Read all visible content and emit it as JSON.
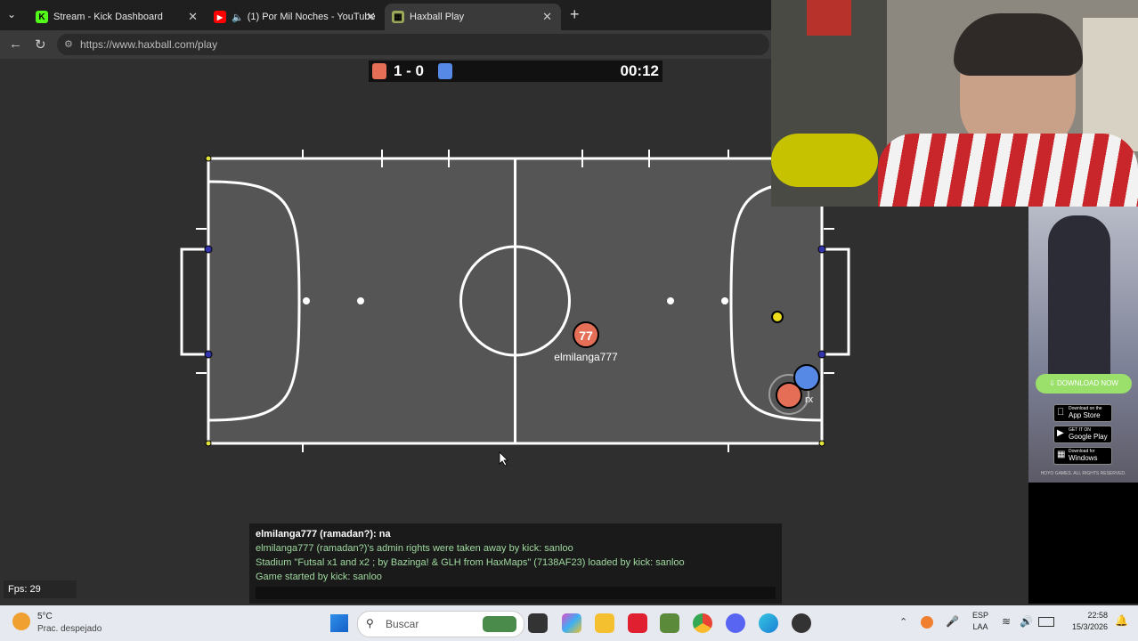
{
  "tabs": [
    {
      "title": "Stream - Kick Dashboard",
      "icon": "kick-icon"
    },
    {
      "title": "(1) Por Mil Noches - YouTube",
      "icon": "youtube-icon"
    },
    {
      "title": "Haxball Play",
      "icon": "haxball-icon"
    }
  ],
  "address": {
    "url": "https://www.haxball.com/play"
  },
  "scoreboard": {
    "score": "1 - 0",
    "time": "00:12",
    "red": "#e56e56",
    "blue": "#5689e5"
  },
  "players": [
    {
      "number": "77",
      "name": "elmilanga777",
      "team": "red"
    },
    {
      "number": "",
      "name": "",
      "team": "red"
    },
    {
      "number": "",
      "name": "",
      "team": "blue"
    }
  ],
  "field": {
    "avatar_partial": "rx"
  },
  "fps": "Fps: 29",
  "chat": {
    "lines": [
      "elmilanga777 (ramadan?): na",
      "elmilanga777 (ramadan?)'s admin rights were taken away by kick: sanloo",
      "Stadium \"Futsal x1 and x2 ; by Bazinga! & GLH from HaxMaps\" (7138AF23) loaded by kick: sanloo",
      "Game started by kick: sanloo"
    ]
  },
  "ad": {
    "download": "DOWNLOAD NOW",
    "stores": [
      {
        "small": "Download on the",
        "big": "App Store"
      },
      {
        "small": "GET IT ON",
        "big": "Google Play"
      },
      {
        "small": "Download for",
        "big": "Windows"
      }
    ],
    "footer": "HOYO GAMES. ALL RIGHTS RESERVED."
  },
  "taskbar": {
    "weather_temp": "5°C",
    "weather_desc": "Prac. despejado",
    "search": "Buscar",
    "lang1": "ESP",
    "lang2": "LAA",
    "time": "22:58",
    "date": "15/3/2026"
  }
}
